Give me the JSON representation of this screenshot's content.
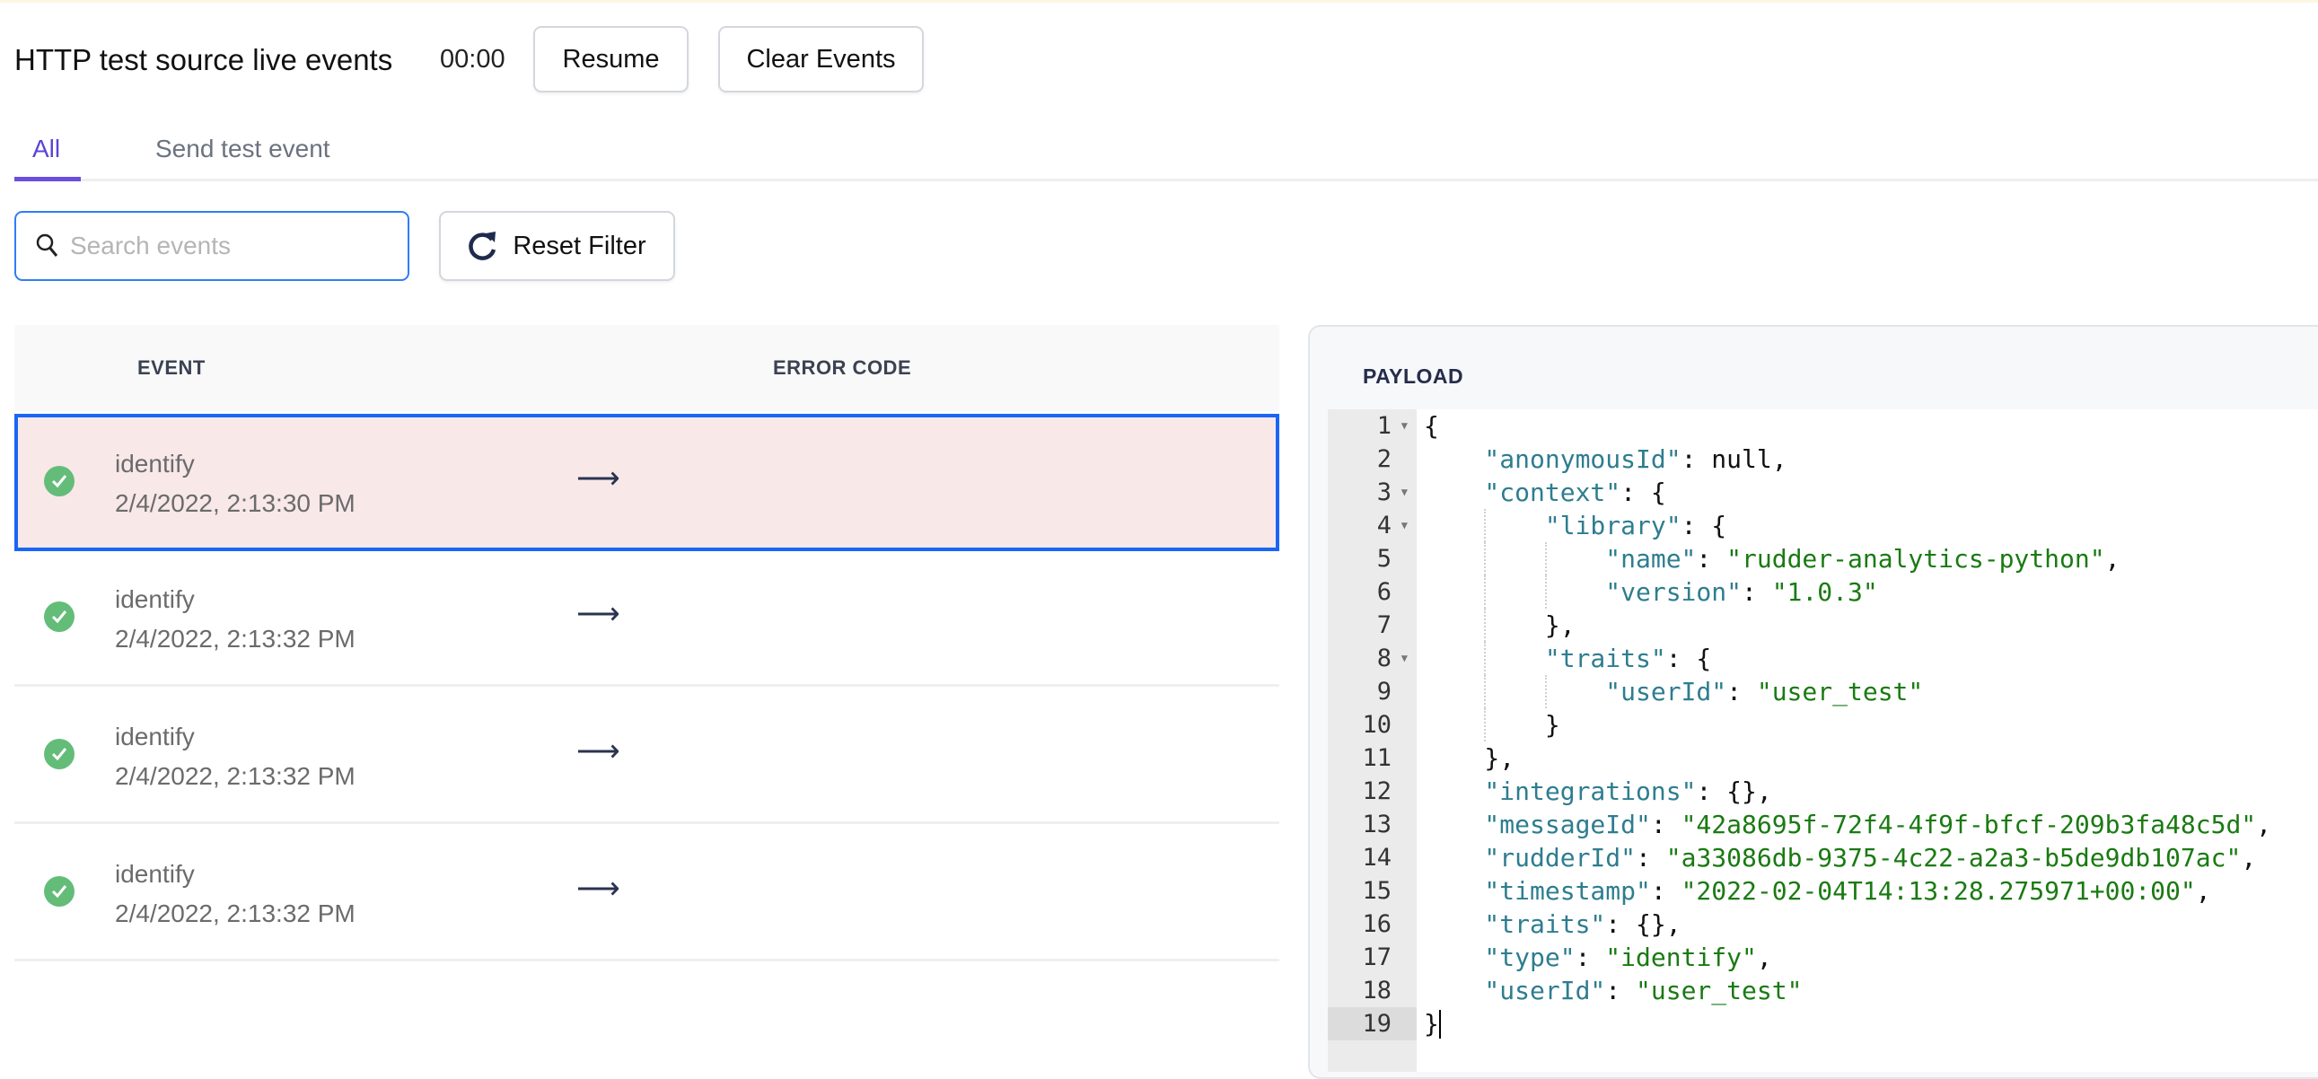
{
  "header": {
    "title": "HTTP test source live events",
    "timer": "00:00",
    "resume_label": "Resume",
    "clear_label": "Clear Events"
  },
  "tabs": [
    {
      "label": "All",
      "active": true
    },
    {
      "label": "Send test event",
      "active": false
    }
  ],
  "filters": {
    "search_placeholder": "Search events",
    "search_value": "",
    "reset_label": "Reset Filter"
  },
  "table": {
    "columns": [
      "EVENT",
      "ERROR CODE"
    ],
    "rows": [
      {
        "event": "identify",
        "timestamp": "2/4/2022, 2:13:30 PM",
        "status": "success",
        "error_code": "",
        "selected": true
      },
      {
        "event": "identify",
        "timestamp": "2/4/2022, 2:13:32 PM",
        "status": "success",
        "error_code": "",
        "selected": false
      },
      {
        "event": "identify",
        "timestamp": "2/4/2022, 2:13:32 PM",
        "status": "success",
        "error_code": "",
        "selected": false
      },
      {
        "event": "identify",
        "timestamp": "2/4/2022, 2:13:32 PM",
        "status": "success",
        "error_code": "",
        "selected": false
      }
    ]
  },
  "payload": {
    "label": "PAYLOAD",
    "current_line": 19,
    "lines": [
      {
        "n": "1",
        "fold": true,
        "indent": 0,
        "tokens": [
          [
            "p",
            "{"
          ]
        ]
      },
      {
        "n": "2",
        "indent": 1,
        "tokens": [
          [
            "k",
            "\"anonymousId\""
          ],
          [
            "p",
            ": null,"
          ]
        ]
      },
      {
        "n": "3",
        "fold": true,
        "indent": 1,
        "tokens": [
          [
            "k",
            "\"context\""
          ],
          [
            "p",
            ": {"
          ]
        ]
      },
      {
        "n": "4",
        "fold": true,
        "indent": 2,
        "tokens": [
          [
            "k",
            "\"library\""
          ],
          [
            "p",
            ": {"
          ]
        ]
      },
      {
        "n": "5",
        "indent": 3,
        "tokens": [
          [
            "k",
            "\"name\""
          ],
          [
            "p",
            ": "
          ],
          [
            "s",
            "\"rudder-analytics-python\""
          ],
          [
            "p",
            ","
          ]
        ]
      },
      {
        "n": "6",
        "indent": 3,
        "tokens": [
          [
            "k",
            "\"version\""
          ],
          [
            "p",
            ": "
          ],
          [
            "s",
            "\"1.0.3\""
          ]
        ]
      },
      {
        "n": "7",
        "indent": 2,
        "tokens": [
          [
            "p",
            "},"
          ]
        ]
      },
      {
        "n": "8",
        "fold": true,
        "indent": 2,
        "tokens": [
          [
            "k",
            "\"traits\""
          ],
          [
            "p",
            ": {"
          ]
        ]
      },
      {
        "n": "9",
        "indent": 3,
        "tokens": [
          [
            "k",
            "\"userId\""
          ],
          [
            "p",
            ": "
          ],
          [
            "s",
            "\"user_test\""
          ]
        ]
      },
      {
        "n": "10",
        "indent": 2,
        "tokens": [
          [
            "p",
            "}"
          ]
        ]
      },
      {
        "n": "11",
        "indent": 1,
        "tokens": [
          [
            "p",
            "},"
          ]
        ]
      },
      {
        "n": "12",
        "indent": 1,
        "tokens": [
          [
            "k",
            "\"integrations\""
          ],
          [
            "p",
            ": {},"
          ]
        ]
      },
      {
        "n": "13",
        "indent": 1,
        "tokens": [
          [
            "k",
            "\"messageId\""
          ],
          [
            "p",
            ": "
          ],
          [
            "s",
            "\"42a8695f-72f4-4f9f-bfcf-209b3fa48c5d\""
          ],
          [
            "p",
            ","
          ]
        ]
      },
      {
        "n": "14",
        "indent": 1,
        "tokens": [
          [
            "k",
            "\"rudderId\""
          ],
          [
            "p",
            ": "
          ],
          [
            "s",
            "\"a33086db-9375-4c22-a2a3-b5de9db107ac\""
          ],
          [
            "p",
            ","
          ]
        ]
      },
      {
        "n": "15",
        "indent": 1,
        "tokens": [
          [
            "k",
            "\"timestamp\""
          ],
          [
            "p",
            ": "
          ],
          [
            "s",
            "\"2022-02-04T14:13:28.275971+00:00\""
          ],
          [
            "p",
            ","
          ]
        ]
      },
      {
        "n": "16",
        "indent": 1,
        "tokens": [
          [
            "k",
            "\"traits\""
          ],
          [
            "p",
            ": {},"
          ]
        ]
      },
      {
        "n": "17",
        "indent": 1,
        "tokens": [
          [
            "k",
            "\"type\""
          ],
          [
            "p",
            ": "
          ],
          [
            "s",
            "\"identify\""
          ],
          [
            "p",
            ","
          ]
        ]
      },
      {
        "n": "18",
        "indent": 1,
        "tokens": [
          [
            "k",
            "\"userId\""
          ],
          [
            "p",
            ": "
          ],
          [
            "s",
            "\"user_test\""
          ]
        ]
      },
      {
        "n": "19",
        "indent": 0,
        "tokens": [
          [
            "p",
            "}"
          ]
        ]
      }
    ]
  },
  "colors": {
    "accent": "#6b4ee0",
    "selected_border": "#1a66f5",
    "selected_bg": "#f8e8e8",
    "success": "#64bc79",
    "json_key": "#2e7d8f",
    "json_string": "#1a7a12"
  },
  "icons": {
    "search": "search-icon",
    "reset": "refresh-icon",
    "status": "check-circle-icon",
    "row_action": "arrow-right-icon",
    "fold": "fold-caret-icon"
  }
}
